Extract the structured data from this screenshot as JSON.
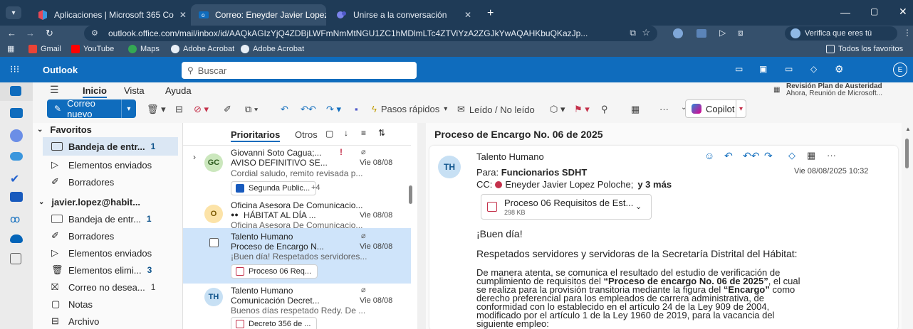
{
  "browser": {
    "tabs": [
      {
        "label": "Aplicaciones | Microsoft 365 Co",
        "close": "✕"
      },
      {
        "label": "Correo: Eneyder Javier Lopez P",
        "close": "✕"
      },
      {
        "label": "Unirse a la conversación",
        "close": "✕"
      }
    ],
    "new_tab": "+",
    "url": "outlook.office.com/mail/inbox/id/AAQkAGIzYjQ4ZDBjLWFmNmMtNGU1ZC1hMDlmLTc4ZTViYzA2ZGJkYwAQAHKbuQKazJp...",
    "verify_label": "Verifica que eres tú",
    "bookmarks": [
      "Gmail",
      "YouTube",
      "Maps",
      "Adobe Acrobat",
      "Adobe Acrobat"
    ],
    "all_favorites": "Todos los favoritos"
  },
  "outlook": {
    "app_name": "Outlook",
    "search_placeholder": "Buscar",
    "avatar_initial": "E",
    "ribbon_tabs": [
      "Inicio",
      "Vista",
      "Ayuda"
    ],
    "new_mail": "Correo nuevo",
    "quick_steps": "Pasos rápidos",
    "read_unread": "Leído / No leído",
    "copilot": "Copilot",
    "more": "···",
    "reminder": {
      "title": "Revisión Plan de Austeridad",
      "detail": "Ahora, Reunión de Microsoft..."
    }
  },
  "folders": {
    "favorites_header": "Favoritos",
    "favorites": [
      {
        "label": "Bandeja de entr...",
        "count": "1"
      },
      {
        "label": "Elementos enviados",
        "count": ""
      },
      {
        "label": "Borradores",
        "count": ""
      }
    ],
    "account": "javier.lopez@habit...",
    "account_items": [
      {
        "label": "Bandeja de entr...",
        "count": "1"
      },
      {
        "label": "Borradores",
        "count": ""
      },
      {
        "label": "Elementos enviados",
        "count": ""
      },
      {
        "label": "Elementos elimi...",
        "count": "3"
      },
      {
        "label": "Correo no desea...",
        "count": "1"
      },
      {
        "label": "Notas",
        "count": ""
      },
      {
        "label": "Archivo",
        "count": ""
      }
    ]
  },
  "list": {
    "tab_focused": "Prioritarios",
    "tab_other": "Otros",
    "messages": [
      {
        "avatar": "GC",
        "sender": "Giovanni Soto Cagua;...",
        "subject": "AVISO DEFINITIVO SE...",
        "date": "Vie 08/08",
        "preview": "Cordial saludo, remito revisada p...",
        "attachment": "Segunda Public...",
        "extra": "+4"
      },
      {
        "avatar": "O",
        "sender": "Oficina Asesora De Comunicacio...",
        "subject": "HÁBITAT AL DÍA ...",
        "date": "Vie 08/08",
        "preview": "Oficina Asesora De Comunicacio...",
        "attachment": "",
        "extra": ""
      },
      {
        "avatar": "",
        "sender": "Talento Humano",
        "subject": "Proceso de Encargo N...",
        "date": "Vie 08/08",
        "preview": "¡Buen día! Respetados servidores...",
        "attachment": "Proceso 06 Req...",
        "extra": ""
      },
      {
        "avatar": "TH",
        "sender": "Talento Humano",
        "subject": "Comunicación Decret...",
        "date": "Vie 08/08",
        "preview": "Buenos días respetado Redy. De ...",
        "attachment": "Decreto 356 de ...",
        "extra": ""
      }
    ]
  },
  "reading": {
    "title": "Proceso de Encargo No. 06 de 2025",
    "avatar": "TH",
    "sender": "Talento Humano",
    "to_label": "Para:",
    "to": "Funcionarios SDHT",
    "cc_label": "CC:",
    "cc": "Eneyder Javier Lopez Poloche;",
    "cc_more": "y 3 más",
    "datetime": "Vie 08/08/2025 10:32",
    "attachment_name": "Proceso 06 Requisitos de Est...",
    "attachment_size": "298 KB",
    "greeting": "¡Buen día!",
    "salutation": "Respetados servidores y servidoras de la Secretaría Distrital del Hábitat:",
    "p1": "De manera atenta, se comunica el resultado del estudio de verificación de",
    "p2a": "cumplimiento de requisitos del ",
    "p2b": "“Proceso de encargo No. 06 de 2025”",
    "p2c": ", el cual",
    "p3a": "se realiza para la provisión transitoria mediante la figura del ",
    "p3b": "“Encargo”",
    "p3c": " como",
    "p4": "derecho preferencial para los empleados de carrera administrativa, de",
    "p5": "conformidad con lo establecido en el artículo 24 de la Ley 909 de 2004,",
    "p6": "modificado por el artículo 1 de la Ley 1960 de 2019, para la vacancia del",
    "p7": "siguiente empleo:"
  },
  "colors": {
    "brand": "#0f6cbd",
    "chrome": "#1f3b57",
    "selected": "#cfe4fa"
  }
}
